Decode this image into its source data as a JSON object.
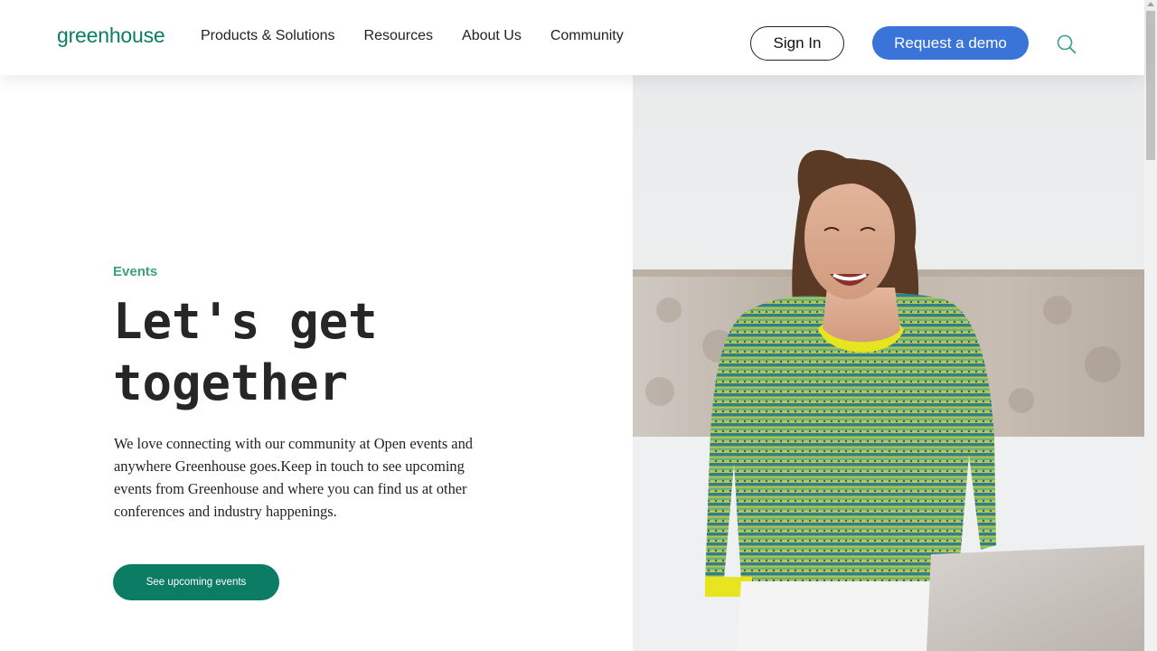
{
  "header": {
    "logo": "greenhouse",
    "nav": [
      {
        "label": "Products & Solutions"
      },
      {
        "label": "Resources"
      },
      {
        "label": "About Us"
      },
      {
        "label": "Community"
      }
    ],
    "sign_in": "Sign In",
    "request_demo": "Request a demo",
    "search_icon": "search-icon"
  },
  "hero": {
    "eyebrow": "Events",
    "title": "Let's get together",
    "body": "We love connecting with our community at Open events and anywhere Greenhouse goes.Keep in touch to see upcoming events from Greenhouse and where you can find us at other conferences and industry happenings.",
    "cta": "See upcoming events"
  },
  "colors": {
    "brand_green": "#0d7c64",
    "accent_green": "#3a9f84",
    "demo_blue": "#3a74d8"
  }
}
